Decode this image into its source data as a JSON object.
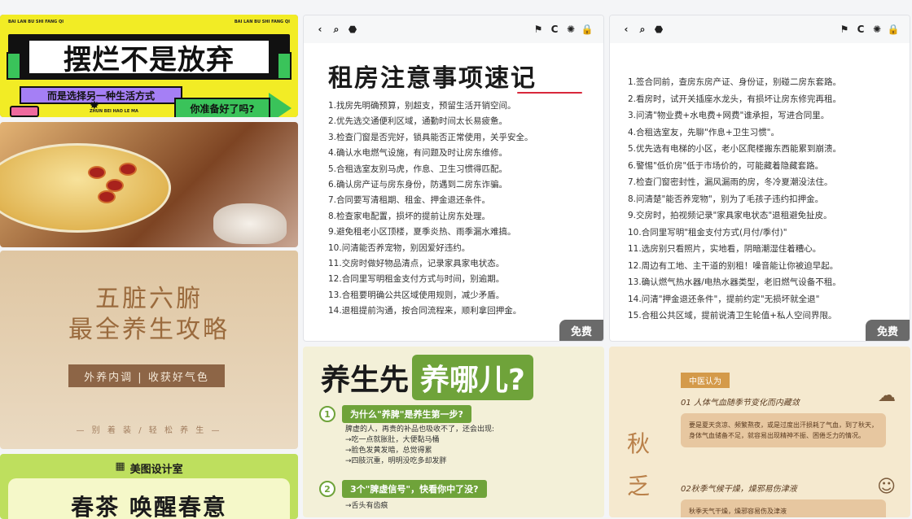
{
  "card1": {
    "small_text": "BAI LAN BU SHI FANG QI",
    "title": "摆烂不是放弃",
    "subtitle": "而是选择另一种生活方式",
    "arrow_text": "你准备好了吗?",
    "pinyin": "ZHUN BEI HAO LE MA"
  },
  "card3": {
    "title_line1": "五脏六腑",
    "title_line2": "最全养生攻略",
    "tag": "外养内调 | 收获好气色",
    "footer": "— 别 着 装 / 轻 松 养 生 —"
  },
  "card4": {
    "brand": "美图设计室",
    "title": "春茶 唤醒春意"
  },
  "toolbar": {
    "back": "‹",
    "search": "⌕",
    "pin": "⬣",
    "flag": "⚑",
    "refresh": "C",
    "settings": "✺",
    "lock": "🔒"
  },
  "doc1": {
    "title": "租房注意事项速记",
    "items": [
      "1.找房先明确预算，别超支，预留生活开销空间。",
      "2.优先选交通便利区域，通勤时间太长易疲惫。",
      "3.检查门窗是否完好，锁具能否正常使用，关乎安全。",
      "4.确认水电燃气设施，有问题及时让房东维修。",
      "5.合租选室友别马虎，作息、卫生习惯得匹配。",
      "6.确认房产证与房东身份，防遇到二房东诈骗。",
      "7.合同要写清租期、租金、押金退还条件。",
      "8.检查家电配置，损坏的提前让房东处理。",
      "9.避免租老小区顶楼，夏季炎热、雨季漏水难搞。",
      "10.问清能否养宠物，别因爱好违约。",
      "11.交房时做好物品清点，记录家具家电状态。",
      "12.合同里写明租金支付方式与时间，别逾期。",
      "13.合租要明确公共区域使用规则，减少矛盾。",
      "14.退租提前沟通，按合同流程来，顺利拿回押金。"
    ],
    "badge": "免费"
  },
  "doc2": {
    "items": [
      "1.签合同前，查房东房产证、身份证，别碰二房东套路。",
      "2.看房时，试开关插座水龙头，有损坏让房东修完再租。",
      "3.问清\"物业费+水电费+网费\"谁承担，写进合同里。",
      "4.合租选室友，先聊\"作息+卫生习惯\"。",
      "5.优先选有电梯的小区，老小区爬楼搬东西能累到崩溃。",
      "6.警惕\"低价房\"低于市场价的，可能藏着隐藏套路。",
      "7.检查门窗密封性，漏风漏雨的房，冬冷夏潮没法住。",
      "8.问清楚\"能否养宠物\"，别为了毛孩子违约扣押金。",
      "9.交房时，拍视频记录\"家具家电状态\"退租避免扯皮。",
      "10.合同里写明\"租金支付方式(月付/季付)\"",
      "11.选房别只看照片，实地看，阴暗潮湿住着糟心。",
      "12.周边有工地、主干道的别租！噪音能让你被迫早起。",
      "13.确认燃气热水器/电热水器类型，老旧燃气设备不租。",
      "14.问清\"押金退还条件\"，提前约定\"无损坏就全退\"",
      "15.合租公共区域，提前说清卫生轮值+私人空间界限。"
    ],
    "badge": "免费"
  },
  "card7": {
    "title_a": "养生先",
    "title_b": "养哪儿?",
    "q1_num": "1",
    "q1": "为什么\"养脾\"是养生第一步?",
    "q1_body": [
      "脾虚的人，再贵的补品也吸收不了，还会出现:",
      "→吃一点就胀肚，大便黏马桶",
      "→脸色发黄发暗，总觉得累",
      "→四肢沉重，明明没吃多却发胖"
    ],
    "q2_num": "2",
    "q2": "3个\"脾虚信号\"，快看你中了没?",
    "q2_body": [
      "→舌头有齿痕"
    ]
  },
  "card8": {
    "tag": "中医认为",
    "h1": "01 人体气血随季节变化而内藏敛",
    "p1": "要是夏天贪凉、频繁熬夜，或是过度出汗损耗了气血，到了秋天，身体气血储备不足，就容易出现精神不振、困倦乏力的情况。",
    "big1": "秋",
    "big2": "乏",
    "h2": "02秋季气候干燥，燥邪易伤津液",
    "p2": "秋季天气干燥，燥邪容易伤及津液"
  }
}
